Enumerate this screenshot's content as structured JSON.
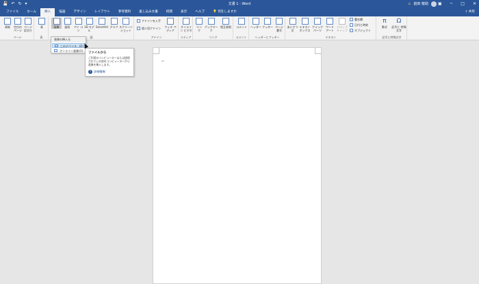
{
  "app": {
    "title": "文書 1 - Word",
    "user_name": "前田 敬助",
    "share_label": "共有",
    "qat": {
      "save_icon": "save-icon",
      "undo_icon": "undo-icon",
      "redo_icon": "redo-icon",
      "more_icon": "customize-icon"
    },
    "window_controls": {
      "minimize": "─",
      "maximize": "□",
      "close": "✕",
      "ribbon_options": "▣"
    },
    "colors": {
      "brand": "#2b579a",
      "ribbon_bg": "#f3f3f3",
      "canvas_bg": "#e6e6e6",
      "highlight": "#cde3f7"
    }
  },
  "tabs": [
    {
      "label": "ファイル",
      "active": false
    },
    {
      "label": "ホーム",
      "active": false
    },
    {
      "label": "挿入",
      "active": true
    },
    {
      "label": "描画",
      "active": false
    },
    {
      "label": "デザイン",
      "active": false
    },
    {
      "label": "レイアウト",
      "active": false
    },
    {
      "label": "参考資料",
      "active": false
    },
    {
      "label": "差し込み文書",
      "active": false
    },
    {
      "label": "校閲",
      "active": false
    },
    {
      "label": "表示",
      "active": false
    },
    {
      "label": "ヘルプ",
      "active": false
    },
    {
      "label": "何をしますか",
      "active": false
    }
  ],
  "ribbon": {
    "groups": {
      "pages": {
        "label": "ページ",
        "buttons": [
          "表紙",
          "空白の ページ",
          "ページ 区切り"
        ]
      },
      "table": {
        "label": "表",
        "buttons": [
          "表"
        ]
      },
      "illustrations": {
        "label": "図",
        "buttons": [
          "画像",
          "図形",
          "アイ コン",
          "3D モデル",
          "SmartArt",
          "グラフ",
          "スクリーン ショット"
        ]
      },
      "addins": {
        "label": "アドイン",
        "buttons": [
          "アドインを入手",
          "個人用アドイン",
          "ウィキ ペディア"
        ]
      },
      "media": {
        "label": "メディア",
        "buttons": [
          "オンライン ビデオ"
        ]
      },
      "links": {
        "label": "リンク",
        "buttons": [
          "リン ク",
          "ブックマーク",
          "相互参照"
        ]
      },
      "comments": {
        "label": "コメント",
        "buttons": [
          "コメント"
        ]
      },
      "header_footer": {
        "label": "ヘッダーとフッター",
        "buttons": [
          "ヘッダー",
          "フッター",
          "ページ 番号"
        ]
      },
      "text": {
        "label": "テキスト",
        "buttons": [
          "あいさつ 文",
          "テキスト ボックス",
          "クイック パーツ",
          "ワード アート",
          "ドロップ キャップ",
          "署名欄",
          "日付と時刻",
          "オブジェクト"
        ]
      },
      "symbols": {
        "label": "記号と特殊文字",
        "buttons": [
          "数式",
          "記号と 特殊文字"
        ]
      }
    }
  },
  "picture_menu": {
    "header": "画像の挿入元",
    "items": [
      {
        "label": "このデバイス...(D)",
        "highlighted": true
      },
      {
        "label": "オンライン画像(O)...",
        "highlighted": false
      }
    ]
  },
  "tooltip": {
    "title": "ファイルから",
    "description": "ご利用のコンピューターまたは接続されている他のコンピューターから画像を挿入します。",
    "link": "詳細情報"
  },
  "document": {
    "paragraph_mark": "↵"
  }
}
